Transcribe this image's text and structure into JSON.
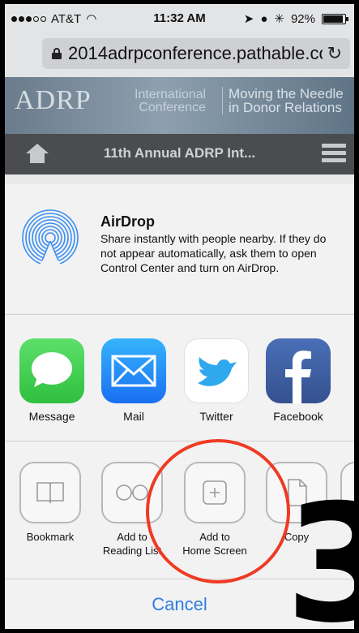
{
  "status": {
    "carrier": "AT&T",
    "time": "11:32 AM",
    "battery": "92%",
    "battery_level": 0.92
  },
  "browser": {
    "url": "2014adrpconference.pathable.co",
    "reload_icon": "reload-icon",
    "lock_icon": "lock-icon"
  },
  "site": {
    "logo": "ADRP",
    "conference": [
      "International",
      "Conference"
    ],
    "tagline": [
      "Moving the Needle",
      "in Donor Relations"
    ],
    "nav_title": "11th Annual ADRP Int...",
    "home_icon": "home-icon",
    "menu_icon": "menu-icon"
  },
  "airdrop": {
    "title": "AirDrop",
    "description": "Share instantly with people nearby. If they do not appear automatically, ask them to open Control Center and turn on AirDrop."
  },
  "apps": [
    {
      "label": "Message",
      "icon": "message-icon",
      "color": "#34c84a"
    },
    {
      "label": "Mail",
      "icon": "mail-icon",
      "color": "#2c8ef6"
    },
    {
      "label": "Twitter",
      "icon": "twitter-icon",
      "color": "#ffffff"
    },
    {
      "label": "Facebook",
      "icon": "facebook-icon",
      "color": "#3b5998"
    }
  ],
  "actions": [
    {
      "label": "Bookmark",
      "icon": "bookmark-icon"
    },
    {
      "label": "Add to Reading List",
      "line1": "Add to",
      "line2": "Reading List",
      "icon": "reading-list-icon"
    },
    {
      "label": "Add to Home Screen",
      "line1": "Add to",
      "line2": "Home Screen",
      "icon": "add-home-screen-icon"
    },
    {
      "label": "Copy",
      "icon": "copy-icon"
    }
  ],
  "cancel_label": "Cancel",
  "annotation": {
    "step_number": "3",
    "highlight_color": "#ef3b24"
  }
}
